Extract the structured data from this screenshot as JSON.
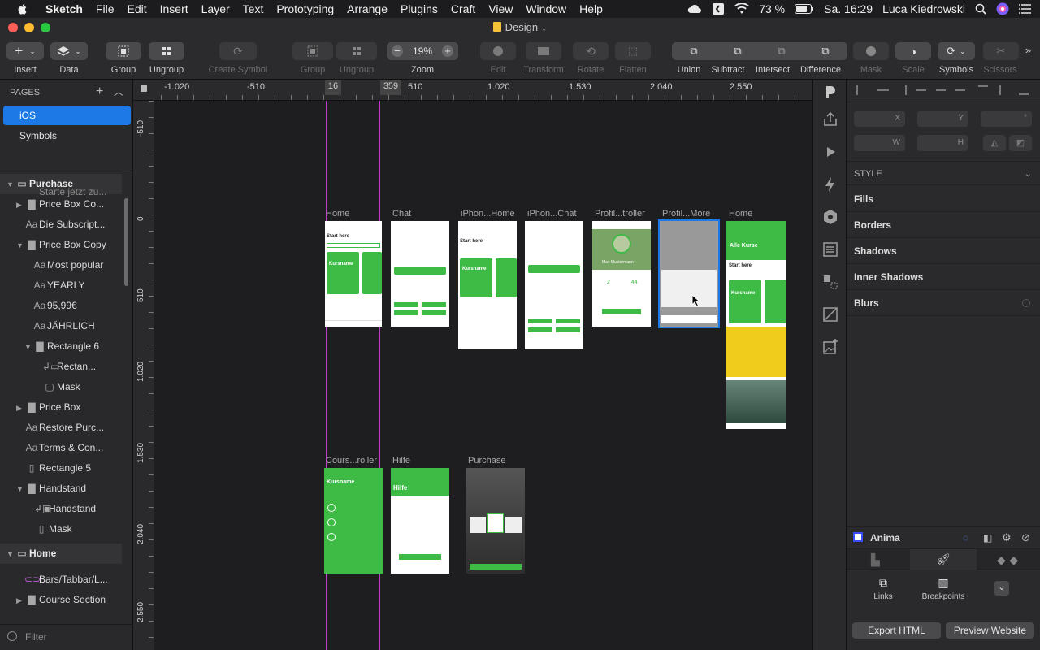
{
  "menubar": {
    "app_name": "Sketch",
    "items": [
      "File",
      "Edit",
      "Insert",
      "Layer",
      "Text",
      "Prototyping",
      "Arrange",
      "Plugins",
      "Craft",
      "View",
      "Window",
      "Help"
    ],
    "battery": "73 %",
    "datetime": "Sa. 16:29",
    "user": "Luca Kiedrowski"
  },
  "window": {
    "title": "Design"
  },
  "toolbar": {
    "insert": "Insert",
    "data": "Data",
    "group": "Group",
    "ungroup": "Ungroup",
    "create_symbol": "Create Symbol",
    "group2": "Group",
    "ungroup2": "Ungroup",
    "zoom_value": "19%",
    "zoom": "Zoom",
    "edit": "Edit",
    "transform": "Transform",
    "rotate": "Rotate",
    "flatten": "Flatten",
    "union": "Union",
    "subtract": "Subtract",
    "intersect": "Intersect",
    "difference": "Difference",
    "mask": "Mask",
    "scale": "Scale",
    "symbols": "Symbols",
    "scissors": "Scissors"
  },
  "pages": {
    "heading": "PAGES",
    "items": [
      "iOS",
      "Symbols"
    ],
    "selected": "iOS"
  },
  "layers": [
    {
      "name": "Purchase",
      "type": "artboard",
      "expanded": true
    },
    {
      "name": "Starte jetzt zu...",
      "type": "text"
    },
    {
      "name": "Price Box Co...",
      "type": "folder",
      "expanded": false
    },
    {
      "name": "Die Subscript...",
      "type": "text"
    },
    {
      "name": "Price Box Copy",
      "type": "folder",
      "expanded": true
    },
    {
      "name": "Most popular",
      "type": "text"
    },
    {
      "name": "YEARLY",
      "type": "text"
    },
    {
      "name": "95,99€",
      "type": "text"
    },
    {
      "name": "JÄHRLICH",
      "type": "text"
    },
    {
      "name": "Rectangle 6",
      "type": "folder",
      "expanded": true
    },
    {
      "name": "Rectan...",
      "type": "shape"
    },
    {
      "name": "Mask",
      "type": "rect"
    },
    {
      "name": "Price Box",
      "type": "folder",
      "expanded": false
    },
    {
      "name": "Restore Purc...",
      "type": "text"
    },
    {
      "name": "Terms & Con...",
      "type": "text"
    },
    {
      "name": "Rectangle 5",
      "type": "rect"
    },
    {
      "name": "Handstand",
      "type": "folder",
      "expanded": true
    },
    {
      "name": "Handstand",
      "type": "image"
    },
    {
      "name": "Mask",
      "type": "rect"
    },
    {
      "name": "Home",
      "type": "artboard",
      "expanded": true
    },
    {
      "name": "Bars/Tabbar/L...",
      "type": "symbol"
    },
    {
      "name": "Course Section",
      "type": "folder",
      "expanded": false
    }
  ],
  "filter_placeholder": "Filter",
  "ruler": {
    "h_labels": [
      "-1.020",
      "-510",
      "16",
      "359",
      "510",
      "1.020",
      "1.530",
      "2.040",
      "2.550"
    ],
    "v_labels": [
      "-510",
      "0",
      "510",
      "1.020",
      "1.530",
      "2.040",
      "2.550"
    ]
  },
  "artboards": [
    {
      "label": "Home"
    },
    {
      "label": "Chat"
    },
    {
      "label": "iPhon...Home"
    },
    {
      "label": "iPhon...Chat"
    },
    {
      "label": "Profil...troller"
    },
    {
      "label": "Profil...More"
    },
    {
      "label": "Home"
    },
    {
      "label": "Cours...roller"
    },
    {
      "label": "Hilfe"
    },
    {
      "label": "Purchase"
    }
  ],
  "artboard_text": {
    "start_here": "Start here",
    "kursname": "Kursname",
    "alle_kurse": "Alle Kurse",
    "hilfe": "Hilfe",
    "profile_name": "Max Mustermann",
    "stat_a": "2",
    "stat_b": "44"
  },
  "inspector": {
    "x": "X",
    "y": "Y",
    "deg": "°",
    "w": "W",
    "h": "H",
    "style_heading": "STYLE",
    "sections": [
      "Fills",
      "Borders",
      "Shadows",
      "Inner Shadows",
      "Blurs"
    ],
    "plugin_name": "Anima",
    "links": "Links",
    "breakpoints": "Breakpoints",
    "export_html": "Export HTML",
    "preview_website": "Preview Website"
  },
  "colors": {
    "accent_green": "#3dbb45",
    "selection_blue": "#1d79e6",
    "guide_magenta": "#c03ccd",
    "yellow_banner": "#f0cd1c"
  }
}
